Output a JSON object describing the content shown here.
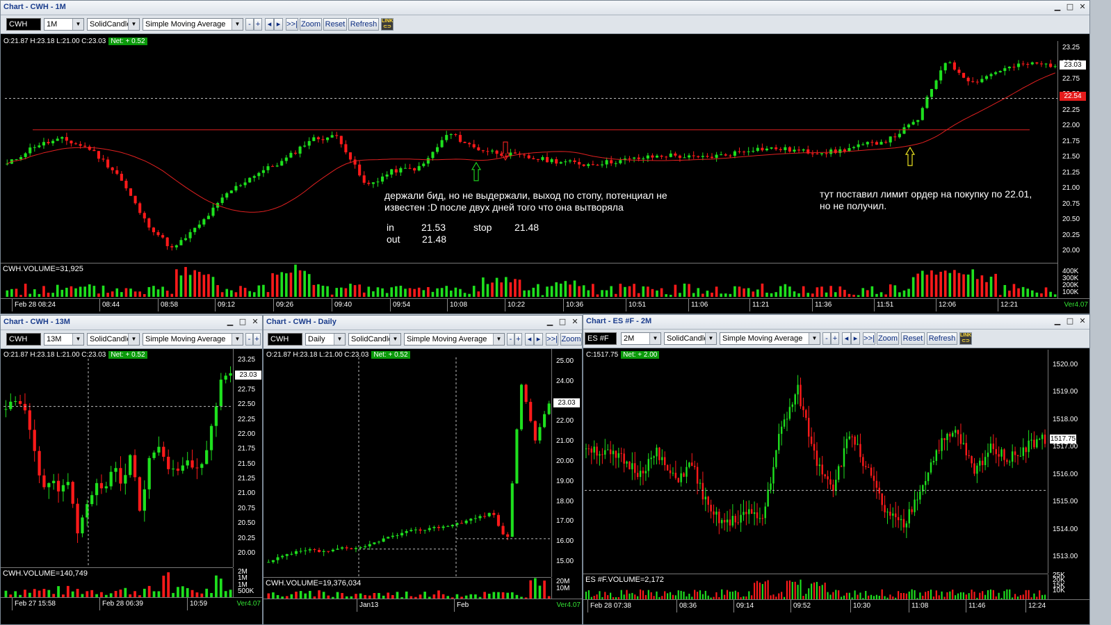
{
  "windows": {
    "main": {
      "title": "Chart - CWH - 1M",
      "toolbar": {
        "symbol": "CWH",
        "interval": "1M",
        "style": "SolidCandle",
        "study": "Simple Moving Average",
        "minus": "-",
        "plus": "+",
        "left": "◂",
        "right": "▸",
        "end": ">>|",
        "zoom": "Zoom",
        "reset": "Reset",
        "refresh": "Refresh"
      },
      "ohlc": "O:21.87  H:23.18  L:21.00  C:23.03",
      "net": "Net: + 0.52",
      "price_ticks": [
        "23.25",
        "23.00",
        "22.75",
        "22.50",
        "22.25",
        "22.00",
        "21.75",
        "21.50",
        "21.25",
        "21.00",
        "20.75",
        "20.50",
        "20.25",
        "20.00"
      ],
      "last_tag": "23.03",
      "ma_tag": "22.54",
      "volume_label": "CWH.VOLUME=31,925",
      "volume_ticks": [
        "400K",
        "300K",
        "200K",
        "100K"
      ],
      "time_labels": [
        "Feb 28 08:24",
        "08:44",
        "08:58",
        "09:12",
        "09:26",
        "09:40",
        "09:54",
        "10:08",
        "10:22",
        "10:36",
        "10:51",
        "11:06",
        "11:21",
        "11:36",
        "11:51",
        "12:06",
        "12:21"
      ],
      "version": "Ver4.07",
      "annotations": {
        "note1_line1": "держали бид, но не выдержали, выход по стопу, потенциал не",
        "note1_line2": "известен :D  после двух дней того что она вытворяла",
        "in_label": "in",
        "in_value": "21.53",
        "stop_label": "stop",
        "stop_value": "21.48",
        "out_label": "out",
        "out_value": "21.48",
        "note2_line1": "тут поставил лимит ордер на покупку по 22.01,",
        "note2_line2": "но не получил."
      }
    },
    "w13": {
      "title": "Chart - CWH - 13M",
      "toolbar": {
        "symbol": "CWH",
        "interval": "13M",
        "style": "SolidCandle",
        "study": "Simple Moving Average",
        "minus": "-",
        "plus": "+"
      },
      "ohlc": "O:21.87  H:23.18  L:21.00  C:23.03",
      "net": "Net: + 0.52",
      "price_ticks": [
        "23.25",
        "23.00",
        "22.75",
        "22.50",
        "22.25",
        "22.00",
        "21.75",
        "21.50",
        "21.25",
        "21.00",
        "20.75",
        "20.50",
        "20.25",
        "20.00"
      ],
      "last_tag": "23.03",
      "volume_label": "CWH.VOLUME=140,749",
      "volume_ticks": [
        "2M",
        "1M",
        "1M",
        "500K"
      ],
      "time_labels": [
        "Feb 27 15:58",
        "Feb 28 06:39",
        "10:59"
      ],
      "version": "Ver4.07"
    },
    "daily": {
      "title": "Chart - CWH - Daily",
      "toolbar": {
        "symbol": "CWH",
        "interval": "Daily",
        "style": "SolidCandle",
        "study": "Simple Moving Average",
        "minus": "-",
        "plus": "+",
        "left": "◂",
        "right": "▸",
        "end": ">>|",
        "zoom": "Zoom"
      },
      "ohlc": "O:21.87  H:23.18  L:21.00  C:23.03",
      "net": "Net: + 0.52",
      "price_ticks": [
        "25.00",
        "24.00",
        "23.00",
        "22.00",
        "21.00",
        "20.00",
        "19.00",
        "18.00",
        "17.00",
        "16.00",
        "15.00"
      ],
      "last_tag": "23.03",
      "volume_label": "CWH.VOLUME=19,376,034",
      "volume_ticks": [
        "20M",
        "10M"
      ],
      "time_labels": [
        "Jan13",
        "Feb"
      ],
      "version": "Ver4.07"
    },
    "es": {
      "title": "Chart - ES #F - 2M",
      "toolbar": {
        "symbol": "ES #F",
        "interval": "2M",
        "style": "SolidCandle",
        "study": "Simple Moving Average",
        "minus": "-",
        "plus": "+",
        "left": "◂",
        "right": "▸",
        "end": ">>|",
        "zoom": "Zoom",
        "reset": "Reset",
        "refresh": "Refresh"
      },
      "ohlc": "C:1517.75",
      "net": "Net: + 2.00",
      "price_ticks": [
        "1520.00",
        "1519.00",
        "1518.00",
        "1517.00",
        "1516.00",
        "1515.00",
        "1514.00",
        "1513.00"
      ],
      "last_tag": "1517.75",
      "volume_label": "ES #F.VOLUME=2,172",
      "volume_ticks": [
        "25K",
        "20K",
        "15K",
        "10K"
      ],
      "time_labels": [
        "Feb 28 07:38",
        "08:36",
        "09:14",
        "09:52",
        "10:30",
        "11:08",
        "11:46",
        "12:24"
      ],
      "version": "Ver4.07"
    }
  },
  "icons": {
    "minimize": "minimize-icon",
    "maximize": "maximize-icon",
    "close": "close-icon",
    "link": "link-icon",
    "arrow_up": "arrow-up-icon",
    "arrow_down": "arrow-down-icon"
  },
  "colors": {
    "up": "#1ee01e",
    "down": "#ff1a1a",
    "ma": "#e02020",
    "level": "#e02020",
    "background": "#000000"
  },
  "chart_data": [
    {
      "type": "candlestick",
      "series": "CWH 1M",
      "ylim": [
        19.9,
        23.3
      ],
      "resistance_level": 22.0,
      "moving_average": "Simple Moving Average",
      "last": 23.03,
      "ma_last": 22.54
    },
    {
      "type": "candlestick",
      "series": "CWH 13M",
      "ylim": [
        19.8,
        23.3
      ],
      "last": 23.03
    },
    {
      "type": "candlestick",
      "series": "CWH Daily",
      "ylim": [
        14.6,
        25.2
      ],
      "last": 23.03
    },
    {
      "type": "candlestick",
      "series": "ES #F 2M",
      "ylim": [
        1512.8,
        1520.6
      ],
      "last": 1517.75
    }
  ]
}
